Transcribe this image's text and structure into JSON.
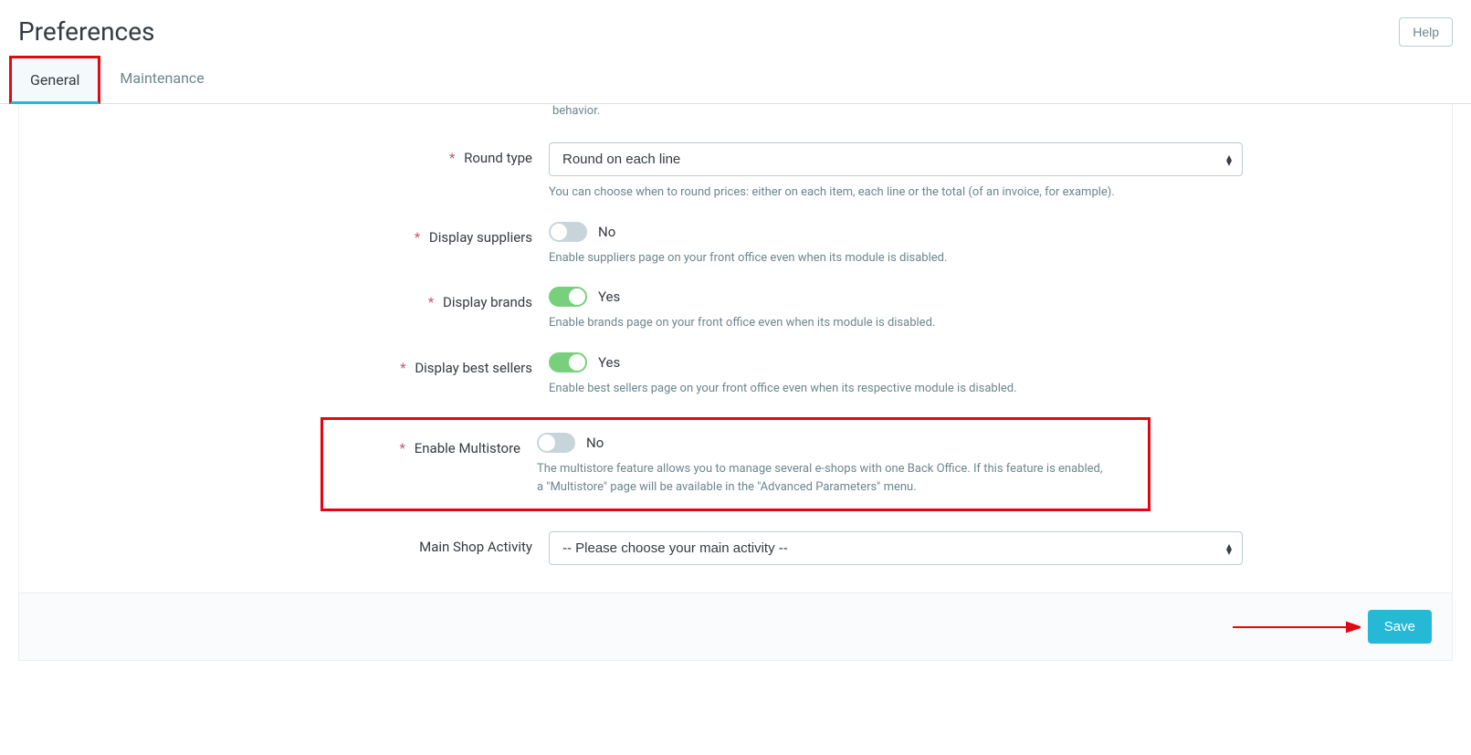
{
  "header": {
    "title": "Preferences",
    "help_label": "Help"
  },
  "tabs": {
    "general": "General",
    "maintenance": "Maintenance"
  },
  "partial_text": "behavior.",
  "fields": {
    "round_type": {
      "label": "Round type",
      "value": "Round on each line",
      "help": "You can choose when to round prices: either on each item, each line or the total (of an invoice, for example)."
    },
    "display_suppliers": {
      "label": "Display suppliers",
      "state": "No",
      "help": "Enable suppliers page on your front office even when its module is disabled."
    },
    "display_brands": {
      "label": "Display brands",
      "state": "Yes",
      "help": "Enable brands page on your front office even when its module is disabled."
    },
    "display_best_sellers": {
      "label": "Display best sellers",
      "state": "Yes",
      "help": "Enable best sellers page on your front office even when its respective module is disabled."
    },
    "enable_multistore": {
      "label": "Enable Multistore",
      "state": "No",
      "help": "The multistore feature allows you to manage several e-shops with one Back Office. If this feature is enabled, a \"Multistore\" page will be available in the \"Advanced Parameters\" menu."
    },
    "main_shop_activity": {
      "label": "Main Shop Activity",
      "value": "-- Please choose your main activity --"
    }
  },
  "footer": {
    "save_label": "Save"
  }
}
